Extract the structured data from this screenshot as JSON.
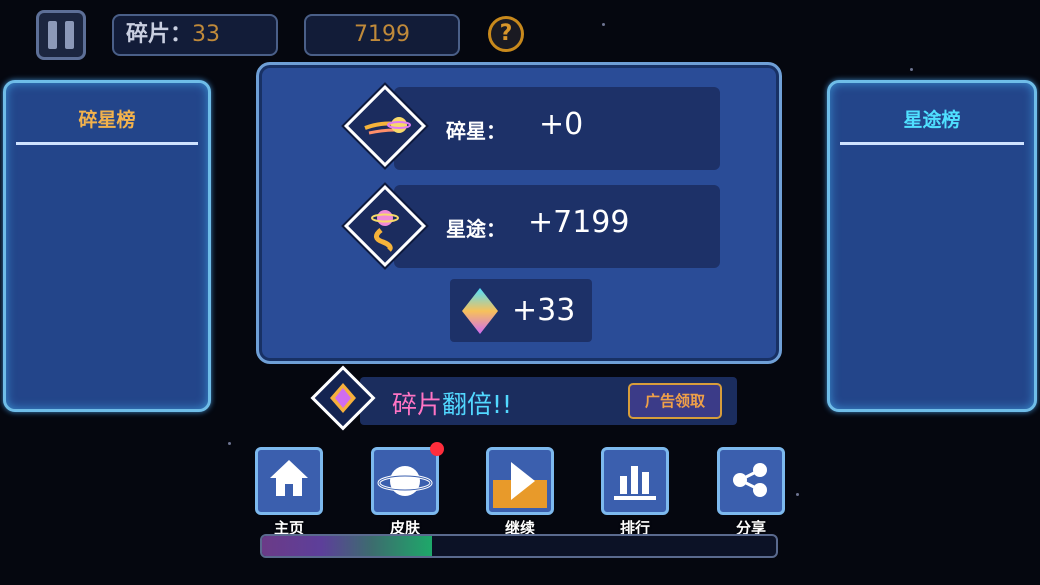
{
  "header": {
    "fragments_label": "碎片：",
    "fragments_value": "33",
    "score": "7199",
    "help_label": "?"
  },
  "leaderboards": {
    "left_title": "碎星榜",
    "right_title": "星途榜"
  },
  "results": {
    "shards_label": "碎星：",
    "shards_value": "+0",
    "journey_label": "星途：",
    "journey_value": "+7199",
    "gems_value": "+33"
  },
  "double_reward": {
    "text_a": "碎片",
    "text_b": "翻倍!!",
    "ad_button": "广告领取"
  },
  "nav": [
    {
      "label": "主页",
      "icon": "home-icon"
    },
    {
      "label": "皮肤",
      "icon": "planet-icon"
    },
    {
      "label": "继续",
      "icon": "play-icon"
    },
    {
      "label": "排行",
      "icon": "bar-chart-icon"
    },
    {
      "label": "分享",
      "icon": "share-icon"
    }
  ],
  "progress": {
    "fraction": 0.33
  },
  "colors": {
    "accent_gold": "#f2b24c",
    "accent_cyan": "#4fe0ff",
    "panel": "#2a4c97"
  }
}
